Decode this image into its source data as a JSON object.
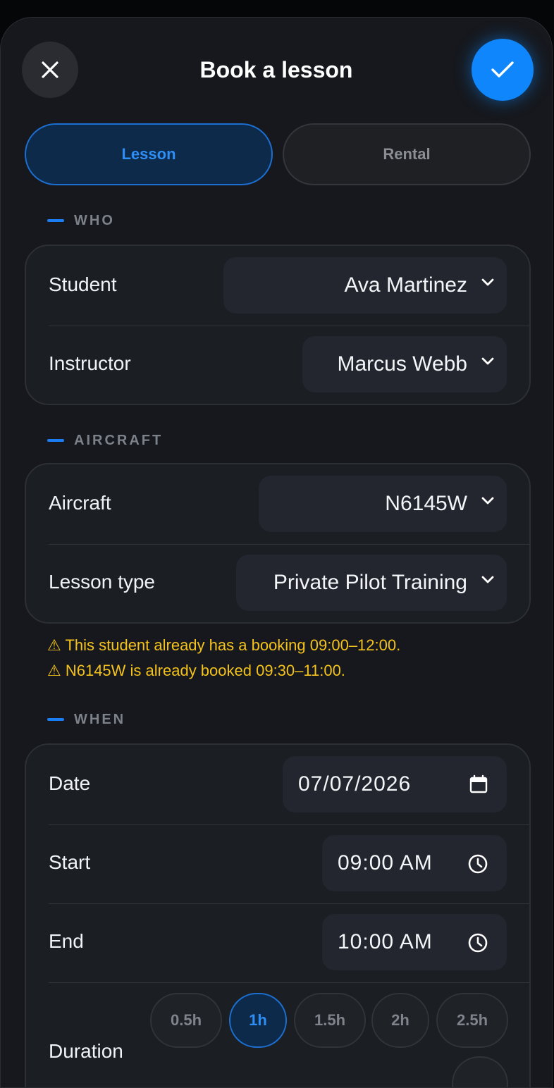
{
  "header": {
    "title": "Book a lesson",
    "close_icon": "close-icon",
    "confirm_icon": "check-icon",
    "accent_color": "#0f86fb"
  },
  "mode_tabs": {
    "lesson_label": "Lesson",
    "rental_label": "Rental",
    "selected": "Lesson"
  },
  "who": {
    "section_label": "WHO",
    "student_label": "Student",
    "student_value": "Ava Martinez",
    "instructor_label": "Instructor",
    "instructor_value": "Marcus Webb"
  },
  "aircraft": {
    "section_label": "AIRCRAFT",
    "aircraft_label": "Aircraft",
    "aircraft_value": "N6145W",
    "lesson_type_label": "Lesson type",
    "lesson_type_value": "Private Pilot Training"
  },
  "warnings": [
    "⚠ This student already has a booking 09:00–12:00.",
    "⚠ N6145W is already booked 09:30–11:00."
  ],
  "when": {
    "section_label": "WHEN",
    "date_label": "Date",
    "date_value": "07/07/2026",
    "start_label": "Start",
    "start_value": "09:00 AM",
    "end_label": "End",
    "end_value": "10:00 AM",
    "duration_label": "Duration",
    "duration_options": [
      "0.5h",
      "1h",
      "1.5h",
      "2h",
      "2.5h"
    ],
    "duration_selected": "1h"
  }
}
